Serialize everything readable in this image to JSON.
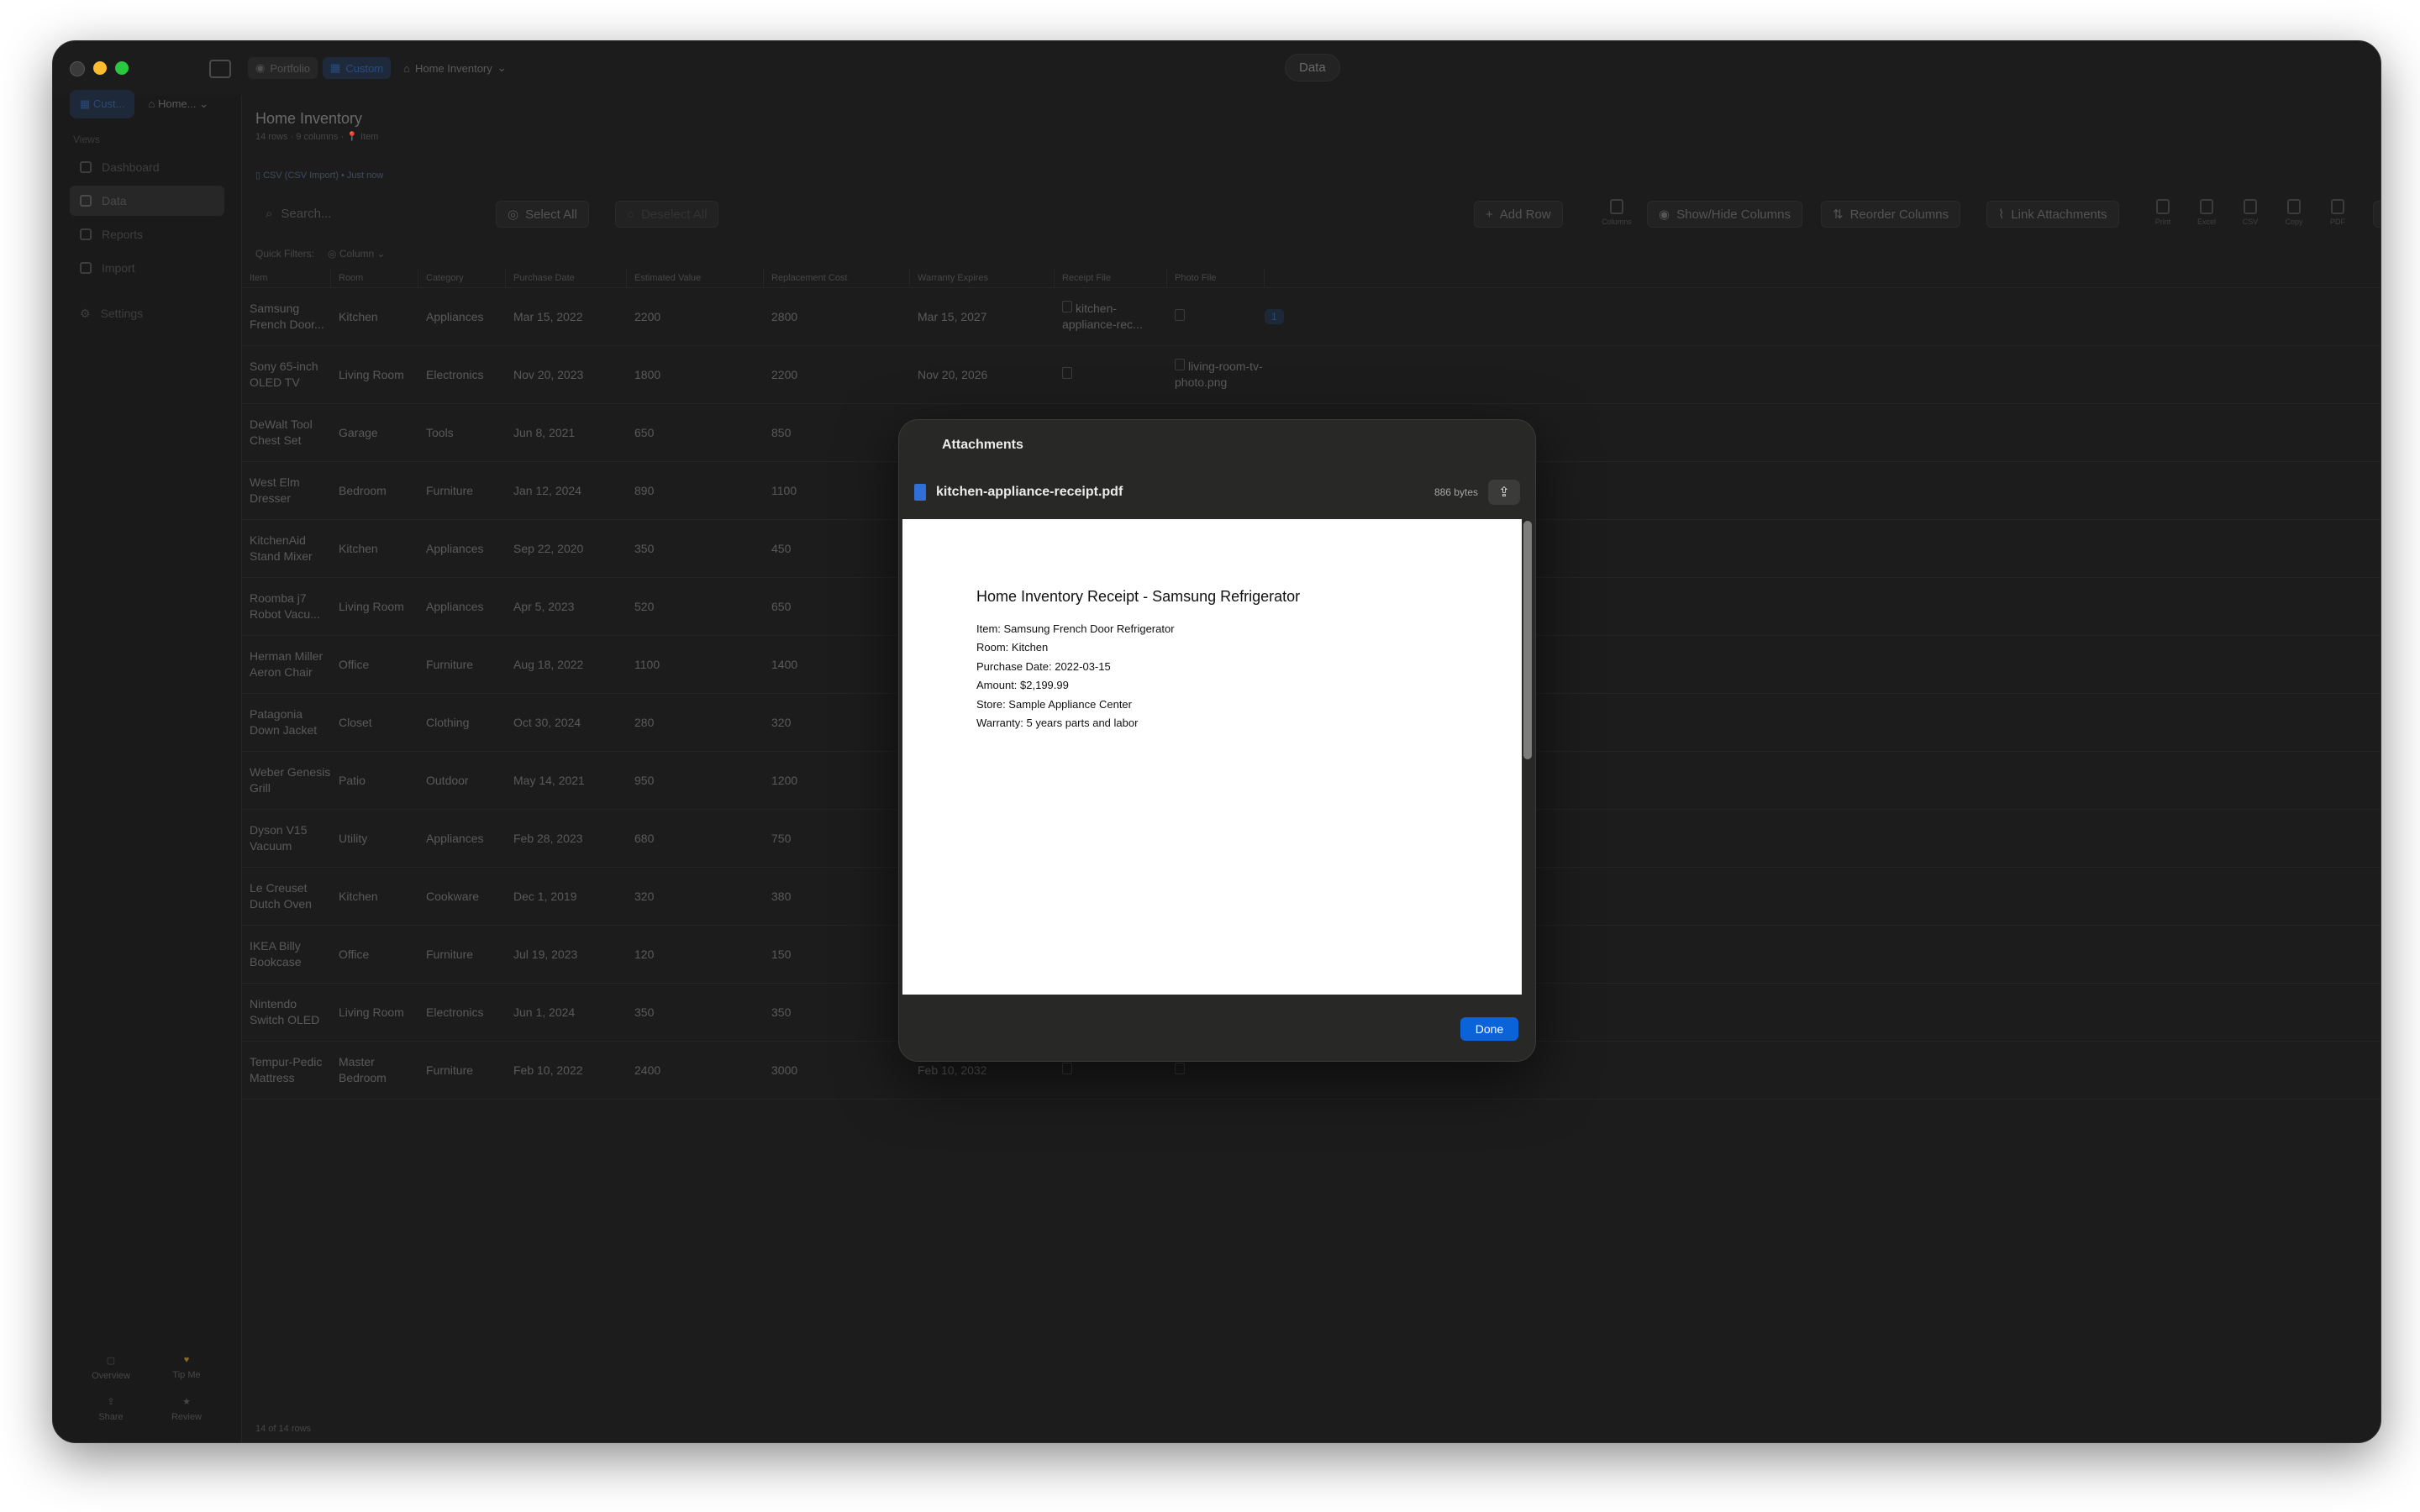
{
  "window": {
    "titlebar": {
      "crumbs": [
        "Portfolio",
        "Custom",
        "Home Inventory"
      ],
      "center_title": "Data"
    }
  },
  "sidebar": {
    "top_tabs": [
      "Cust...",
      "Home..."
    ],
    "views_heading": "Views",
    "items": [
      {
        "label": "Dashboard",
        "icon": "grid-icon"
      },
      {
        "label": "Data",
        "icon": "table-icon"
      },
      {
        "label": "Reports",
        "icon": "report-icon"
      },
      {
        "label": "Import",
        "icon": "import-icon"
      },
      {
        "label": "Settings",
        "icon": "gear-icon"
      }
    ],
    "footer": [
      {
        "label": "Overview",
        "icon": "overview-icon"
      },
      {
        "label": "Tip Me",
        "icon": "heart-icon"
      },
      {
        "label": "Share",
        "icon": "share-icon"
      },
      {
        "label": "Review",
        "icon": "star-icon"
      }
    ]
  },
  "main": {
    "title": "Home Inventory",
    "meta": "14 rows · 9 columns · 📍 Item",
    "source": "CSV (CSV Import) • Just now",
    "search_placeholder": "Search...",
    "buttons": {
      "select_all": "Select All",
      "deselect_all": "Deselect All",
      "add_row": "Add Row",
      "columns": "Columns",
      "show_hide": "Show/Hide Columns",
      "reorder": "Reorder Columns",
      "link_attachments": "Link Attachments",
      "print": "Print",
      "excel": "Excel",
      "csv": "CSV",
      "copy": "Copy",
      "pdf": "PDF"
    },
    "quick_filters": {
      "label": "Quick Filters:",
      "column": "Column"
    },
    "table": {
      "columns": [
        "Item",
        "Room",
        "Category",
        "Purchase Date",
        "Estimated Value",
        "Replacement Cost",
        "Warranty Expires",
        "Receipt File",
        "Photo File"
      ],
      "rows": [
        {
          "item": "Samsung French Door...",
          "room": "Kitchen",
          "category": "Appliances",
          "date": "Mar 15, 2022",
          "value": "2200",
          "cost": "2800",
          "warranty": "Mar 15, 2027",
          "receipt": "kitchen-appliance-rec...",
          "photo": "",
          "badge": "1"
        },
        {
          "item": "Sony 65-inch OLED TV",
          "room": "Living Room",
          "category": "Electronics",
          "date": "Nov 20, 2023",
          "value": "1800",
          "cost": "2200",
          "warranty": "Nov 20, 2026",
          "receipt": "",
          "photo": "living-room-tv-photo.png",
          "badge": ""
        },
        {
          "item": "DeWalt Tool Chest Set",
          "room": "Garage",
          "category": "Tools",
          "date": "Jun 8, 2021",
          "value": "650",
          "cost": "850",
          "warranty": "",
          "receipt": "",
          "photo": "",
          "badge": ""
        },
        {
          "item": "West Elm Dresser",
          "room": "Bedroom",
          "category": "Furniture",
          "date": "Jan 12, 2024",
          "value": "890",
          "cost": "1100",
          "warranty": "",
          "receipt": "",
          "photo": "",
          "badge": ""
        },
        {
          "item": "KitchenAid Stand Mixer",
          "room": "Kitchen",
          "category": "Appliances",
          "date": "Sep 22, 2020",
          "value": "350",
          "cost": "450",
          "warranty": "",
          "receipt": "",
          "photo": "",
          "badge": ""
        },
        {
          "item": "Roomba j7 Robot Vacu...",
          "room": "Living Room",
          "category": "Appliances",
          "date": "Apr 5, 2023",
          "value": "520",
          "cost": "650",
          "warranty": "",
          "receipt": "",
          "photo": "",
          "badge": ""
        },
        {
          "item": "Herman Miller Aeron Chair",
          "room": "Office",
          "category": "Furniture",
          "date": "Aug 18, 2022",
          "value": "1100",
          "cost": "1400",
          "warranty": "",
          "receipt": "",
          "photo": "",
          "badge": ""
        },
        {
          "item": "Patagonia Down Jacket",
          "room": "Closet",
          "category": "Clothing",
          "date": "Oct 30, 2024",
          "value": "280",
          "cost": "320",
          "warranty": "",
          "receipt": "",
          "photo": "",
          "badge": ""
        },
        {
          "item": "Weber Genesis Grill",
          "room": "Patio",
          "category": "Outdoor",
          "date": "May 14, 2021",
          "value": "950",
          "cost": "1200",
          "warranty": "",
          "receipt": "",
          "photo": "",
          "badge": ""
        },
        {
          "item": "Dyson V15 Vacuum",
          "room": "Utility",
          "category": "Appliances",
          "date": "Feb 28, 2023",
          "value": "680",
          "cost": "750",
          "warranty": "",
          "receipt": "",
          "photo": "",
          "badge": ""
        },
        {
          "item": "Le Creuset Dutch Oven",
          "room": "Kitchen",
          "category": "Cookware",
          "date": "Dec 1, 2019",
          "value": "320",
          "cost": "380",
          "warranty": "",
          "receipt": "",
          "photo": "",
          "badge": ""
        },
        {
          "item": "IKEA Billy Bookcase",
          "room": "Office",
          "category": "Furniture",
          "date": "Jul 19, 2023",
          "value": "120",
          "cost": "150",
          "warranty": "",
          "receipt": "",
          "photo": "",
          "badge": ""
        },
        {
          "item": "Nintendo Switch OLED",
          "room": "Living Room",
          "category": "Electronics",
          "date": "Jun 1, 2024",
          "value": "350",
          "cost": "350",
          "warranty": "",
          "receipt": "",
          "photo": "",
          "badge": ""
        },
        {
          "item": "Tempur-Pedic Mattress",
          "room": "Master Bedroom",
          "category": "Furniture",
          "date": "Feb 10, 2022",
          "value": "2400",
          "cost": "3000",
          "warranty": "Feb 10, 2032",
          "receipt": "",
          "photo": "",
          "badge": ""
        }
      ]
    },
    "footer_count": "14 of 14 rows"
  },
  "modal": {
    "title": "Attachments",
    "file_name": "kitchen-appliance-receipt.pdf",
    "file_size": "886 bytes",
    "pdf": {
      "heading": "Home Inventory Receipt - Samsung Refrigerator",
      "lines": [
        "Item: Samsung French Door Refrigerator",
        "Room: Kitchen",
        "Purchase Date: 2022-03-15",
        "Amount: $2,199.99",
        "Store: Sample Appliance Center",
        "Warranty: 5 years parts and labor"
      ]
    },
    "done_label": "Done"
  },
  "colors": {
    "accent": "#0a63d8",
    "close": "#ff5f57",
    "minimize": "#febc2e",
    "zoom": "#28c840"
  }
}
